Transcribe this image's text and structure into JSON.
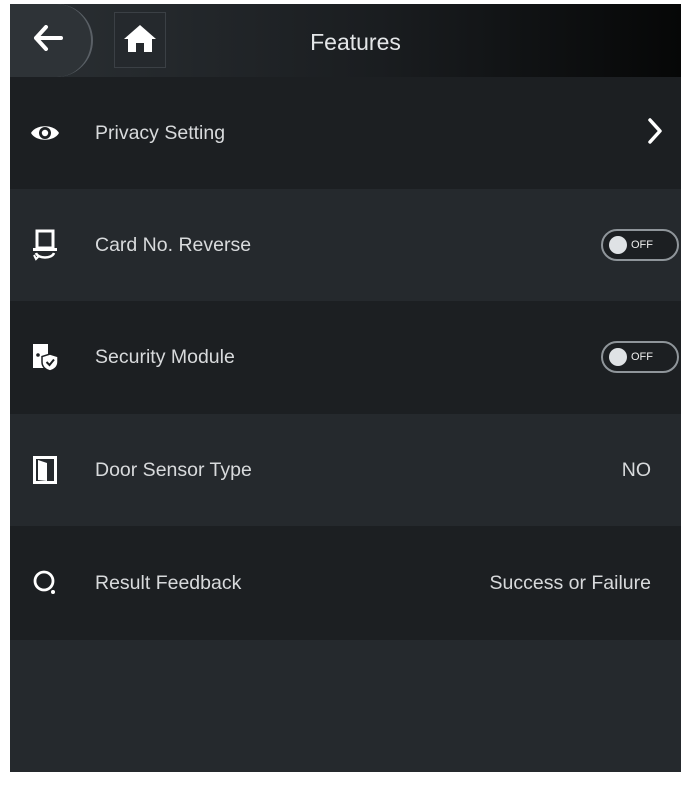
{
  "header": {
    "title": "Features",
    "back_icon": "arrow-left-icon",
    "home_icon": "home-icon"
  },
  "rows": [
    {
      "label": "Privacy Setting",
      "icon": "eye-icon",
      "control": "chevron"
    },
    {
      "label": "Card No. Reverse",
      "icon": "card-reverse-icon",
      "control": "toggle",
      "toggle_text": "OFF",
      "toggle_on": false
    },
    {
      "label": "Security Module",
      "icon": "security-module-icon",
      "control": "toggle",
      "toggle_text": "OFF",
      "toggle_on": false
    },
    {
      "label": "Door Sensor Type",
      "icon": "door-icon",
      "control": "value",
      "value": "NO"
    },
    {
      "label": "Result Feedback",
      "icon": "feedback-icon",
      "control": "value",
      "value": "Success or Failure"
    }
  ],
  "colors": {
    "background": "#1c1f22",
    "row_alt": "#25292d",
    "text": "#d8dadc",
    "title": "#e4e6e8"
  }
}
